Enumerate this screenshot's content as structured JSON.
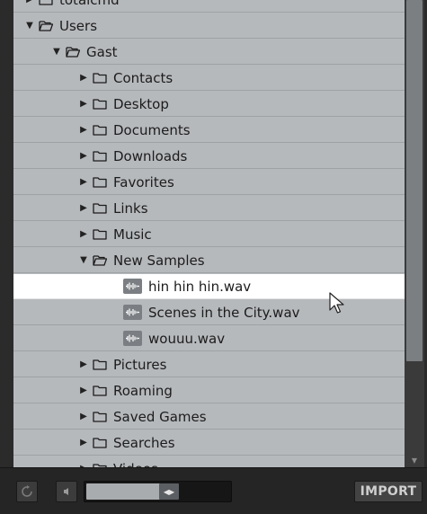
{
  "tree": {
    "rows": [
      {
        "label": "totalcmd",
        "type": "folder",
        "expanded": false,
        "depth": 1,
        "selected": false
      },
      {
        "label": "Users",
        "type": "folder",
        "expanded": true,
        "depth": 1,
        "selected": false
      },
      {
        "label": "Gast",
        "type": "folder",
        "expanded": true,
        "depth": 2,
        "selected": false
      },
      {
        "label": "Contacts",
        "type": "folder",
        "expanded": false,
        "depth": 3,
        "selected": false
      },
      {
        "label": "Desktop",
        "type": "folder",
        "expanded": false,
        "depth": 3,
        "selected": false
      },
      {
        "label": "Documents",
        "type": "folder",
        "expanded": false,
        "depth": 3,
        "selected": false
      },
      {
        "label": "Downloads",
        "type": "folder",
        "expanded": false,
        "depth": 3,
        "selected": false
      },
      {
        "label": "Favorites",
        "type": "folder",
        "expanded": false,
        "depth": 3,
        "selected": false
      },
      {
        "label": "Links",
        "type": "folder",
        "expanded": false,
        "depth": 3,
        "selected": false
      },
      {
        "label": "Music",
        "type": "folder",
        "expanded": false,
        "depth": 3,
        "selected": false
      },
      {
        "label": "New Samples",
        "type": "folder",
        "expanded": true,
        "depth": 3,
        "selected": false
      },
      {
        "label": "hin hin hin.wav",
        "type": "file",
        "depth": 4,
        "selected": true
      },
      {
        "label": "Scenes in the City.wav",
        "type": "file",
        "depth": 4,
        "selected": false
      },
      {
        "label": "wouuu.wav",
        "type": "file",
        "depth": 4,
        "selected": false
      },
      {
        "label": "Pictures",
        "type": "folder",
        "expanded": false,
        "depth": 3,
        "selected": false
      },
      {
        "label": "Roaming",
        "type": "folder",
        "expanded": false,
        "depth": 3,
        "selected": false
      },
      {
        "label": "Saved Games",
        "type": "folder",
        "expanded": false,
        "depth": 3,
        "selected": false
      },
      {
        "label": "Searches",
        "type": "folder",
        "expanded": false,
        "depth": 3,
        "selected": false
      },
      {
        "label": "Videos",
        "type": "folder",
        "expanded": false,
        "depth": 3,
        "selected": false
      }
    ]
  },
  "icons": {
    "expanded": "triangle-down-icon",
    "collapsed": "triangle-right-icon",
    "folder": "folder-icon",
    "folder_open": "folder-open-icon",
    "file": "waveform-icon"
  },
  "bottom_bar": {
    "import_label": "IMPORT",
    "volume_level": 0.65
  },
  "colors": {
    "row_bg": "#b6b9bc",
    "selected_bg": "#ffffff",
    "panel_bg": "#2b2b2b"
  }
}
